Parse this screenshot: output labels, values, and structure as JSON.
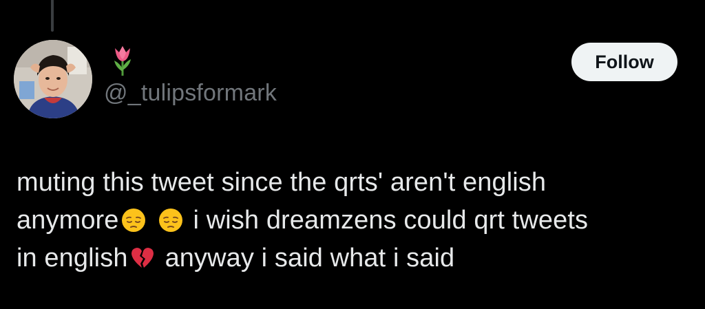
{
  "tweet": {
    "author_handle": "@_tulipsformark",
    "name_emoji": "tulip-icon",
    "follow_label": "Follow",
    "lines": [
      {
        "parts": [
          "muting this tweet since the qrts' aren't english"
        ]
      },
      {
        "parts": [
          "anymore",
          "i wish dreamzens could qrt tweets"
        ]
      },
      {
        "parts": [
          "in english",
          "anyway i said what i said"
        ]
      }
    ],
    "emojis": [
      "pensive-face-icon",
      "pensive-face-icon",
      "broken-heart-icon"
    ]
  },
  "colors": {
    "background": "#000000",
    "text": "#e7e9ea",
    "secondary_text": "#71767b",
    "button_bg": "#eff3f4",
    "button_text": "#0f1419",
    "thread_line": "#3a3d40"
  }
}
